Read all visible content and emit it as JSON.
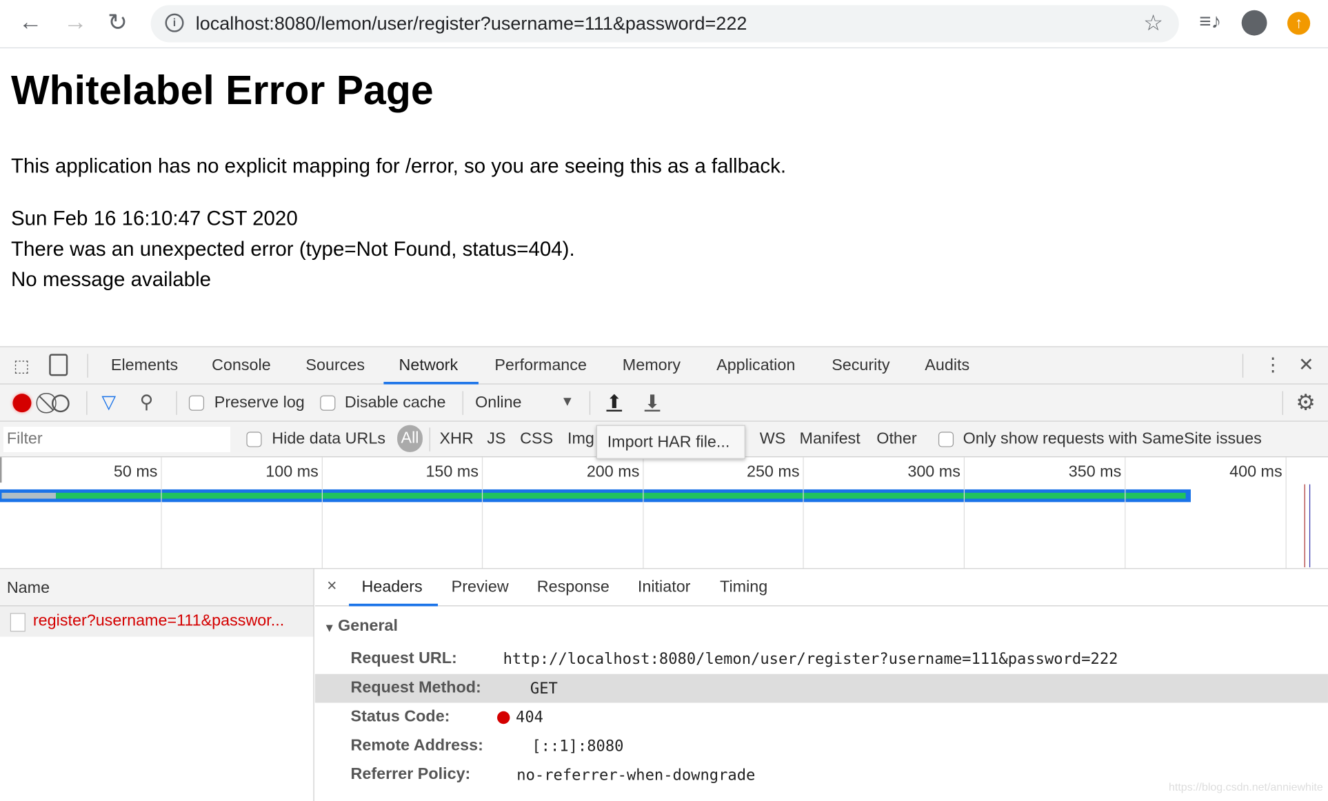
{
  "browser": {
    "url": "localhost:8080/lemon/user/register?username=111&password=222",
    "icons": [
      "back-icon",
      "forward-icon",
      "reload-icon",
      "info-icon",
      "star-icon",
      "media-icon",
      "profile-icon",
      "update-icon"
    ]
  },
  "page": {
    "title": "Whitelabel Error Page",
    "message": "This application has no explicit mapping for /error, so you are seeing this as a fallback.",
    "date": "Sun Feb 16 16:10:47 CST 2020",
    "error": "There was an unexpected error (type=Not Found, status=404).",
    "detail": "No message available"
  },
  "devtools": {
    "tabs": [
      "Elements",
      "Console",
      "Sources",
      "Network",
      "Performance",
      "Memory",
      "Application",
      "Security",
      "Audits"
    ],
    "active_tab": "Network",
    "toolbar": {
      "preserve_log": "Preserve log",
      "disable_cache": "Disable cache",
      "throttle": "Online"
    },
    "filter": {
      "placeholder": "Filter",
      "hide_data_urls": "Hide data URLs",
      "types": [
        "All",
        "XHR",
        "JS",
        "CSS",
        "Img"
      ],
      "types2": [
        "WS",
        "Manifest",
        "Other"
      ],
      "samesite": "Only show requests with SameSite issues",
      "tooltip": "Import HAR file..."
    },
    "timeline": {
      "ticks": [
        "50 ms",
        "100 ms",
        "150 ms",
        "200 ms",
        "250 ms",
        "300 ms",
        "350 ms",
        "400 ms"
      ]
    },
    "requests": {
      "header": "Name",
      "items": [
        "register?username=111&passwor..."
      ]
    },
    "detail": {
      "tabs": [
        "Headers",
        "Preview",
        "Response",
        "Initiator",
        "Timing"
      ],
      "section": "General",
      "rows": [
        {
          "k": "Request URL:",
          "v": "http://localhost:8080/lemon/user/register?username=111&password=222"
        },
        {
          "k": "Request Method:",
          "v": "GET"
        },
        {
          "k": "Status Code:",
          "v": "404"
        },
        {
          "k": "Remote Address:",
          "v": "[::1]:8080"
        },
        {
          "k": "Referrer Policy:",
          "v": "no-referrer-when-downgrade"
        }
      ]
    },
    "colors": {
      "accent": "#1a73e8",
      "error": "#d40000",
      "green": "#21c25e"
    }
  },
  "watermark": "https://blog.csdn.net/anniewhite"
}
